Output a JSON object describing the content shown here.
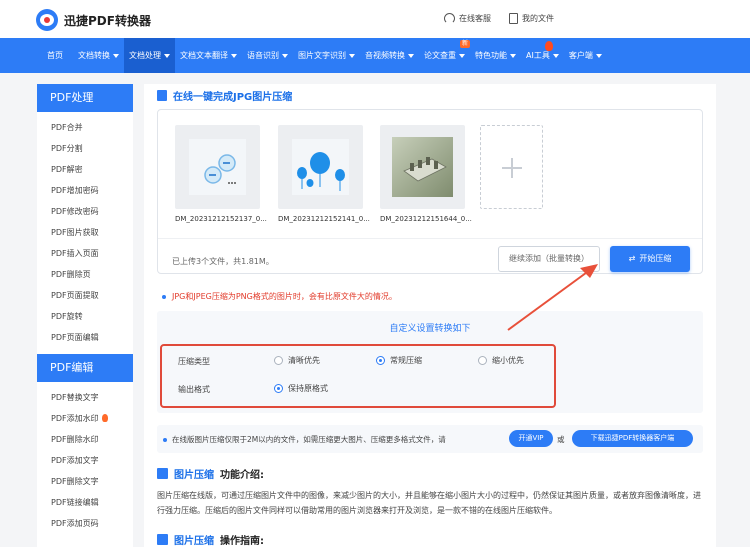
{
  "header": {
    "logo_text": "迅捷PDF转换器",
    "links": [
      {
        "label": "在线客服",
        "icon": "headset-icon"
      },
      {
        "label": "我的文件",
        "icon": "file-icon"
      }
    ]
  },
  "nav": {
    "items": [
      {
        "label": "首页",
        "dropdown": false
      },
      {
        "label": "文档转换",
        "dropdown": true
      },
      {
        "label": "文档处理",
        "dropdown": true,
        "active": true
      },
      {
        "label": "文档文本翻译",
        "dropdown": true
      },
      {
        "label": "语音识别",
        "dropdown": true
      },
      {
        "label": "图片文字识别",
        "dropdown": true
      },
      {
        "label": "音视频转换",
        "dropdown": true
      },
      {
        "label": "论文查重",
        "dropdown": true,
        "badge": "新"
      },
      {
        "label": "特色功能",
        "dropdown": true
      },
      {
        "label": "AI工具",
        "dropdown": true,
        "flame": true
      },
      {
        "label": "客户端",
        "dropdown": true
      }
    ]
  },
  "sidebar": {
    "group1": {
      "title": "PDF处理",
      "items": [
        "PDF合并",
        "PDF分割",
        "PDF解密",
        "PDF增加密码",
        "PDF修改密码",
        "PDF图片获取",
        "PDF插入页面",
        "PDF删除页",
        "PDF页面提取",
        "PDF旋转",
        "PDF页面编辑"
      ]
    },
    "group2": {
      "title": "PDF编辑",
      "items": [
        {
          "label": "PDF替换文字",
          "hot": false
        },
        {
          "label": "PDF添加水印",
          "hot": true
        },
        {
          "label": "PDF删除水印",
          "hot": false
        },
        {
          "label": "PDF添加文字",
          "hot": false
        },
        {
          "label": "PDF删除文字",
          "hot": false
        },
        {
          "label": "PDF链接编辑",
          "hot": false
        },
        {
          "label": "PDF添加页码",
          "hot": false
        }
      ]
    }
  },
  "main": {
    "title": "在线一键完成JPG图片压缩",
    "files": [
      {
        "name": "DM_20231212152137_0..."
      },
      {
        "name": "DM_20231212152141_0..."
      },
      {
        "name": "DM_20231212151644_0..."
      }
    ],
    "upload_summary": "已上传3个文件，共1.81M。",
    "continue_button": "继续添加（批量转换）",
    "start_button": "开始压缩",
    "note": "JPG和JPEG压缩为PNG格式的图片时，会有比原文件大的情况。",
    "settings": {
      "title": "自定义设置转换如下",
      "compress_label": "压缩类型",
      "compress_options": [
        {
          "label": "清晰优先",
          "checked": false
        },
        {
          "label": "常规压缩",
          "checked": true
        },
        {
          "label": "缩小优先",
          "checked": false
        }
      ],
      "format_label": "输出格式",
      "format_options": [
        {
          "label": "保持原格式",
          "checked": true
        }
      ]
    },
    "limit": {
      "text": "在线版图片压缩仅限于2M以内的文件，如需压缩更大图片、压缩更多格式文件，请",
      "vip_button": "开通VIP",
      "or": "或",
      "download_button": "下载迅捷PDF转换器客户端"
    },
    "intro": {
      "heading_highlight": "图片压缩",
      "heading_rest": "功能介绍:",
      "paragraph": "图片压缩在线版，可通过压缩图片文件中的图像，来减少图片的大小，并且能够在缩小图片大小的过程中，仍然保证其图片质量，或者放弃图像清晰度，进行强力压缩。压缩后的图片文件同样可以借助常用的图片浏览器来打开及浏览，是一款不错的在线图片压缩软件。"
    },
    "guide": {
      "heading_highlight": "图片压缩",
      "heading_rest": "操作指南:"
    }
  },
  "colors": {
    "brand": "#2d7cf6",
    "highlight_frame": "#e04a3a",
    "arrow": "#e8503a"
  }
}
